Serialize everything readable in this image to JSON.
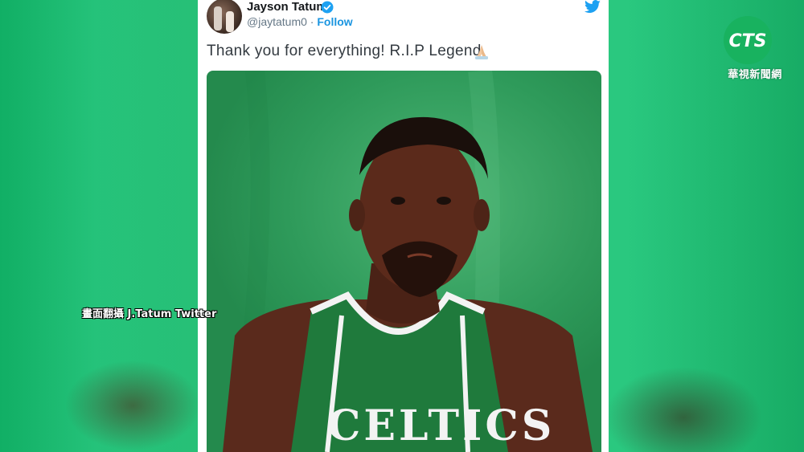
{
  "tweet": {
    "user_name": "Jayson Tatum",
    "handle": "@jaytatum0",
    "separator": " · ",
    "follow_label": "Follow",
    "text": "Thank you for everything! R.I.P Legend",
    "verified_icon": "verified-badge-icon",
    "platform_icon": "twitter-bird-icon",
    "emoji_icon": "folded-hands-icon",
    "photo_jersey_text": "CELTICS"
  },
  "overlay": {
    "caption": "畫面翻攝 J.Tatum Twitter"
  },
  "channel_logo": {
    "brand": "CTS",
    "subtitle": "華視新聞網"
  },
  "colors": {
    "follow": "#1b95e0",
    "background_green": "#22c277",
    "cts_green": "#18b25f",
    "cts_blue": "#1a5fb4"
  }
}
